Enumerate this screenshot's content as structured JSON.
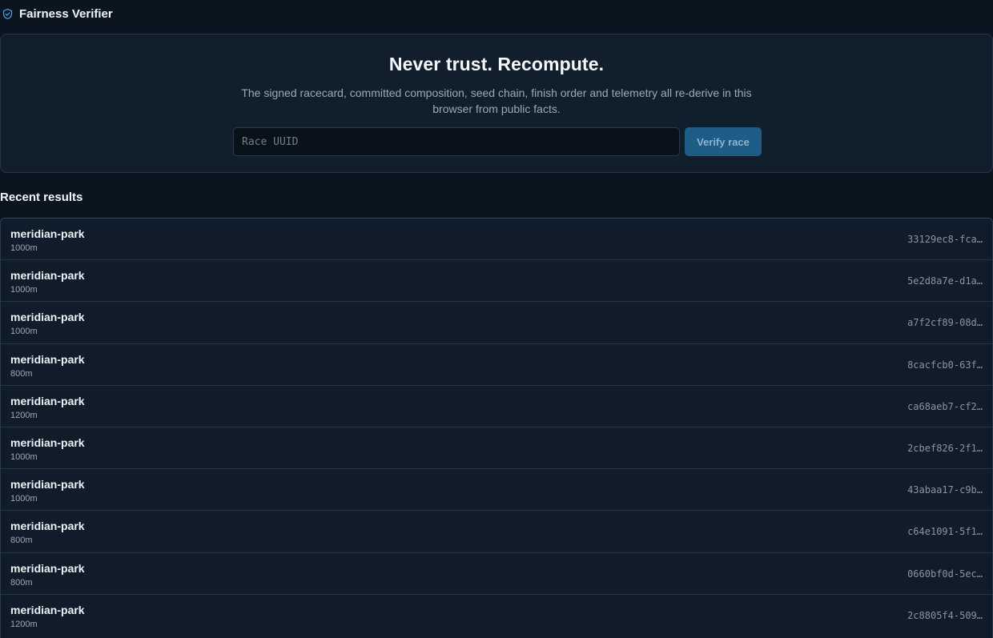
{
  "header": {
    "app_title": "Fairness Verifier",
    "icon": "shield-check-icon"
  },
  "hero": {
    "title": "Never trust. Recompute.",
    "description": "The signed racecard, committed composition, seed chain, finish order and telemetry all re-derive in this browser from public facts.",
    "input_placeholder": "Race UUID",
    "input_value": "",
    "verify_label": "Verify race"
  },
  "recent": {
    "title": "Recent results",
    "rows": [
      {
        "track": "meridian-park",
        "distance": "1000m",
        "uuid": "33129ec8-fca…"
      },
      {
        "track": "meridian-park",
        "distance": "1000m",
        "uuid": "5e2d8a7e-d1a…"
      },
      {
        "track": "meridian-park",
        "distance": "1000m",
        "uuid": "a7f2cf89-08d…"
      },
      {
        "track": "meridian-park",
        "distance": "800m",
        "uuid": "8cacfcb0-63f…"
      },
      {
        "track": "meridian-park",
        "distance": "1200m",
        "uuid": "ca68aeb7-cf2…"
      },
      {
        "track": "meridian-park",
        "distance": "1000m",
        "uuid": "2cbef826-2f1…"
      },
      {
        "track": "meridian-park",
        "distance": "1000m",
        "uuid": "43abaa17-c9b…"
      },
      {
        "track": "meridian-park",
        "distance": "800m",
        "uuid": "c64e1091-5f1…"
      },
      {
        "track": "meridian-park",
        "distance": "800m",
        "uuid": "0660bf0d-5ec…"
      },
      {
        "track": "meridian-park",
        "distance": "1200m",
        "uuid": "2c8805f4-509…"
      }
    ]
  },
  "colors": {
    "accent": "#1d5c86",
    "icon": "#4aa3df",
    "background": "#0b1520",
    "panel": "#111f2d"
  }
}
